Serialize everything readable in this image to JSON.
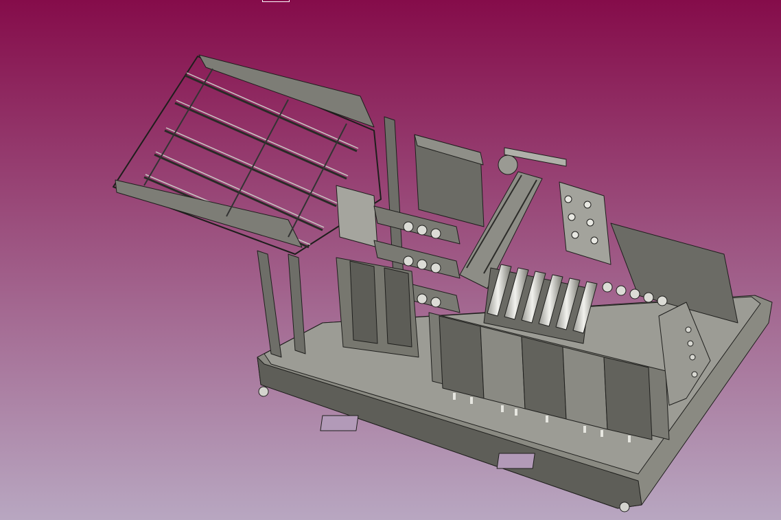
{
  "viewport": {
    "background_top": "#850c4a",
    "background_bottom": "#b8a7c1",
    "model_color": "#8a8a82",
    "model_dark": "#52524d",
    "model_light": "#c9c9c3",
    "edge_color": "#1e1e1c"
  },
  "icons": {
    "model": "cad-assembly-model",
    "view_box": "selection-box-icon"
  }
}
